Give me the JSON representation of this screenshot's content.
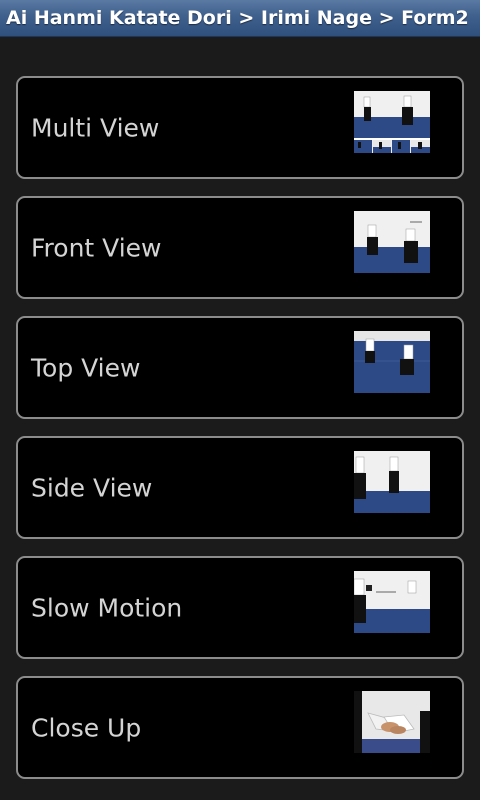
{
  "header": {
    "title": "Ai Hanmi Katate Dori > Irimi Nage > Form2"
  },
  "items": [
    {
      "label": "Multi View",
      "thumb_icon": "multi-view-thumbnail"
    },
    {
      "label": "Front View",
      "thumb_icon": "front-view-thumbnail"
    },
    {
      "label": "Top View",
      "thumb_icon": "top-view-thumbnail"
    },
    {
      "label": "Side View",
      "thumb_icon": "side-view-thumbnail"
    },
    {
      "label": "Slow Motion",
      "thumb_icon": "slow-motion-thumbnail"
    },
    {
      "label": "Close Up",
      "thumb_icon": "close-up-thumbnail"
    }
  ],
  "colors": {
    "title_bar": "#3f5f8c",
    "item_background": "#000000",
    "item_border": "#8c8c8c",
    "mat_blue": "#2d4a86",
    "label_text": "#d4d4d4"
  }
}
